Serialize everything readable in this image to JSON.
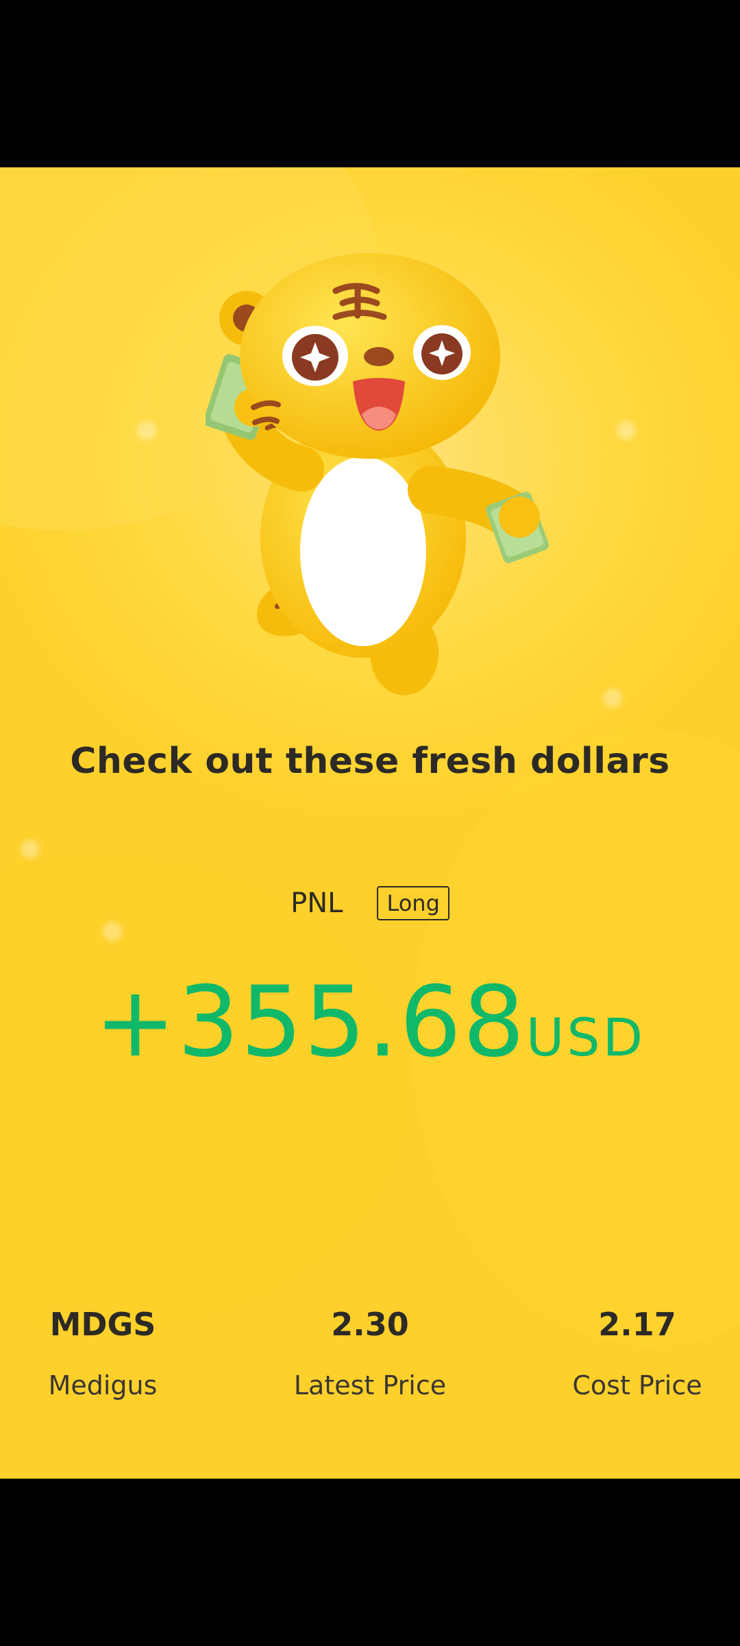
{
  "card": {
    "headline": "Check out these fresh dollars",
    "pnl": {
      "label": "PNL",
      "position_badge": "Long",
      "amount": "+355.68",
      "currency": "USD",
      "amount_color": "#10B869"
    },
    "stats": [
      {
        "value": "MDGS",
        "label": "Medigus"
      },
      {
        "value": "2.30",
        "label": "Latest Price"
      },
      {
        "value": "2.17",
        "label": "Cost Price"
      }
    ],
    "background_color": "#FFD93F",
    "mascot": "tiger-mascot-holding-cash"
  }
}
